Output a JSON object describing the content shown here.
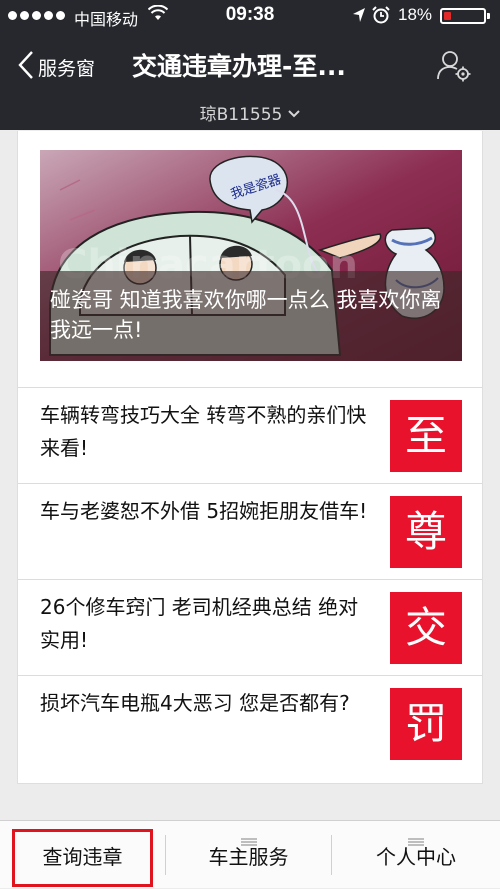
{
  "status_bar": {
    "carrier": "中国移动",
    "time": "09:38",
    "battery": "18%"
  },
  "nav": {
    "back_label": "服务窗",
    "title": "交通违章办理-至...",
    "plate": "琼B11555",
    "icons": [
      "chevron-left-icon",
      "user-settings-icon",
      "chevron-down-icon"
    ]
  },
  "hero": {
    "caption": "碰瓷哥 知道我喜欢你哪一点么 我喜欢你离我远一点!",
    "bubble_text": "我是瓷器",
    "watermark": "Chinacartoon"
  },
  "articles": [
    {
      "title": "车辆转弯技巧大全 转弯不熟的亲们快来看!",
      "thumb": "至"
    },
    {
      "title": "车与老婆恕不外借 5招婉拒朋友借车!",
      "thumb": "尊"
    },
    {
      "title": "26个修车窍门 老司机经典总结 绝对实用!",
      "thumb": "交"
    },
    {
      "title": "损坏汽车电瓶4大恶习 您是否都有?",
      "thumb": "罚"
    }
  ],
  "tabs": [
    {
      "label": "查询违章",
      "has_menu": false
    },
    {
      "label": "车主服务",
      "has_menu": true
    },
    {
      "label": "个人中心",
      "has_menu": true
    }
  ],
  "colors": {
    "header_bg": "#26282d",
    "thumb_red": "#e8122c",
    "highlight_red": "#e0141f"
  }
}
